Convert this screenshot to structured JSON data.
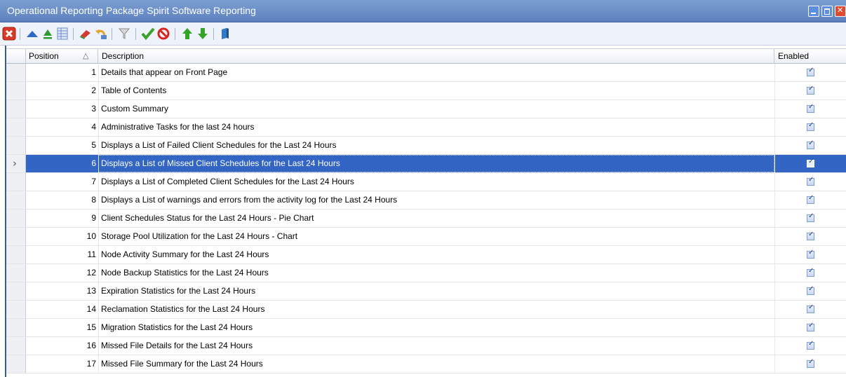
{
  "window": {
    "title": "Operational Reporting Package Spirit Software Reporting"
  },
  "toolbar": {
    "buttons": [
      {
        "icon": "close-icon",
        "color": "#d83a2a"
      },
      {
        "icon": "move-up-icon",
        "color": "#2b69c9"
      },
      {
        "icon": "move-top-icon",
        "color": "#2e9b2e"
      },
      {
        "icon": "grid-icon",
        "color": "#6d8fc8"
      },
      {
        "icon": "eraser-icon",
        "color": "#d23b2f"
      },
      {
        "icon": "undo-icon",
        "color": "#e2a42a"
      },
      {
        "icon": "filter-icon",
        "color": "#8a8a8a"
      },
      {
        "icon": "check-icon",
        "color": "#3aa12a"
      },
      {
        "icon": "stop-icon",
        "color": "#d8261d"
      },
      {
        "icon": "arrow-up-icon",
        "color": "#34a428"
      },
      {
        "icon": "arrow-down-icon",
        "color": "#34a428"
      },
      {
        "icon": "book-icon",
        "color": "#2f79c5"
      }
    ]
  },
  "grid": {
    "columns": {
      "position": "Position",
      "sort_indicator": "△",
      "description": "Description",
      "enabled": "Enabled"
    },
    "selected_index": 5,
    "rows": [
      {
        "position": "1",
        "description": "Details that appear on Front Page",
        "enabled": true
      },
      {
        "position": "2",
        "description": "Table of Contents",
        "enabled": true
      },
      {
        "position": "3",
        "description": "Custom Summary",
        "enabled": true
      },
      {
        "position": "4",
        "description": "Administrative Tasks for the last 24 hours",
        "enabled": true
      },
      {
        "position": "5",
        "description": "Displays a List of Failed Client Schedules for the Last 24 Hours",
        "enabled": true
      },
      {
        "position": "6",
        "description": "Displays a List of Missed Client Schedules for the Last 24 Hours",
        "enabled": true
      },
      {
        "position": "7",
        "description": "Displays a List of Completed Client Schedules for the Last 24 Hours",
        "enabled": true
      },
      {
        "position": "8",
        "description": "Displays a List of warnings and errors from the activity log for the Last 24 Hours",
        "enabled": true
      },
      {
        "position": "9",
        "description": "Client Schedules Status for the Last 24 Hours - Pie Chart",
        "enabled": true
      },
      {
        "position": "10",
        "description": "Storage Pool Utilization for the Last 24 Hours - Chart",
        "enabled": true
      },
      {
        "position": "11",
        "description": "Node Activity Summary for the Last 24 Hours",
        "enabled": true
      },
      {
        "position": "12",
        "description": "Node Backup Statistics for the Last 24 Hours",
        "enabled": true
      },
      {
        "position": "13",
        "description": "Expiration Statistics for the Last 24 Hours",
        "enabled": true
      },
      {
        "position": "14",
        "description": "Reclamation Statistics for the Last 24 Hours",
        "enabled": true
      },
      {
        "position": "15",
        "description": "Migration Statistics for the Last 24 Hours",
        "enabled": true
      },
      {
        "position": "16",
        "description": "Missed File Details for the Last 24 Hours",
        "enabled": true
      },
      {
        "position": "17",
        "description": "Missed File Summary for the Last 24 Hours",
        "enabled": true
      }
    ]
  }
}
